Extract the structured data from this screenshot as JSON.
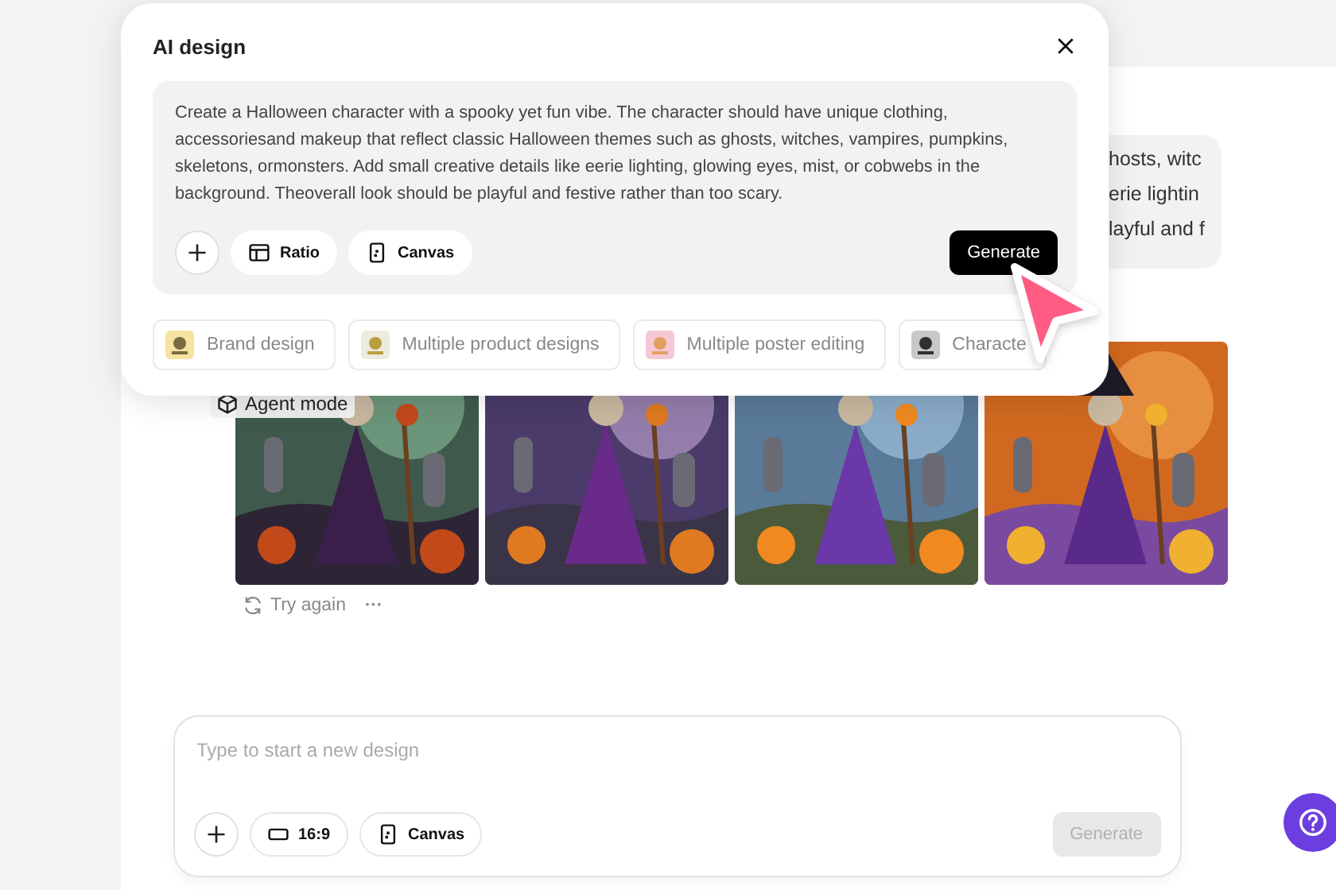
{
  "dialog": {
    "title": "AI design",
    "prompt": "Create a Halloween character with a spooky yet fun vibe. The character should have unique clothing, accessoriesand makeup that reflect classic Halloween themes such as ghosts, witches, vampires, pumpkins, skeletons, ormonsters. Add small creative details like eerie lighting, glowing eyes, mist, or cobwebs in the background. Theoverall look should be playful and festive rather than too scary.",
    "options": [
      {
        "kind": "ratio",
        "label": "Ratio"
      },
      {
        "kind": "canvas",
        "label": "Canvas"
      }
    ],
    "generate": "Generate",
    "suggestions": [
      {
        "label": "Brand design"
      },
      {
        "label": "Multiple product designs"
      },
      {
        "label": "Multiple poster editing"
      },
      {
        "label": "Characte"
      }
    ]
  },
  "conversation": {
    "prompt_lines": [
      "hosts, witc",
      "erie lightin",
      "layful and f"
    ],
    "agent_mode": "Agent mode",
    "images": [
      {
        "kind": "picture"
      },
      {
        "kind": "picture"
      },
      {
        "kind": "picture"
      },
      {
        "kind": "picture"
      }
    ],
    "try_again": "Try again",
    "more": "···"
  },
  "composer": {
    "placeholder": "Type to start a new design",
    "options": [
      {
        "kind": "ratio",
        "label": "16:9"
      },
      {
        "kind": "canvas",
        "label": "Canvas"
      }
    ],
    "generate": "Generate",
    "generate_disabled": true
  }
}
